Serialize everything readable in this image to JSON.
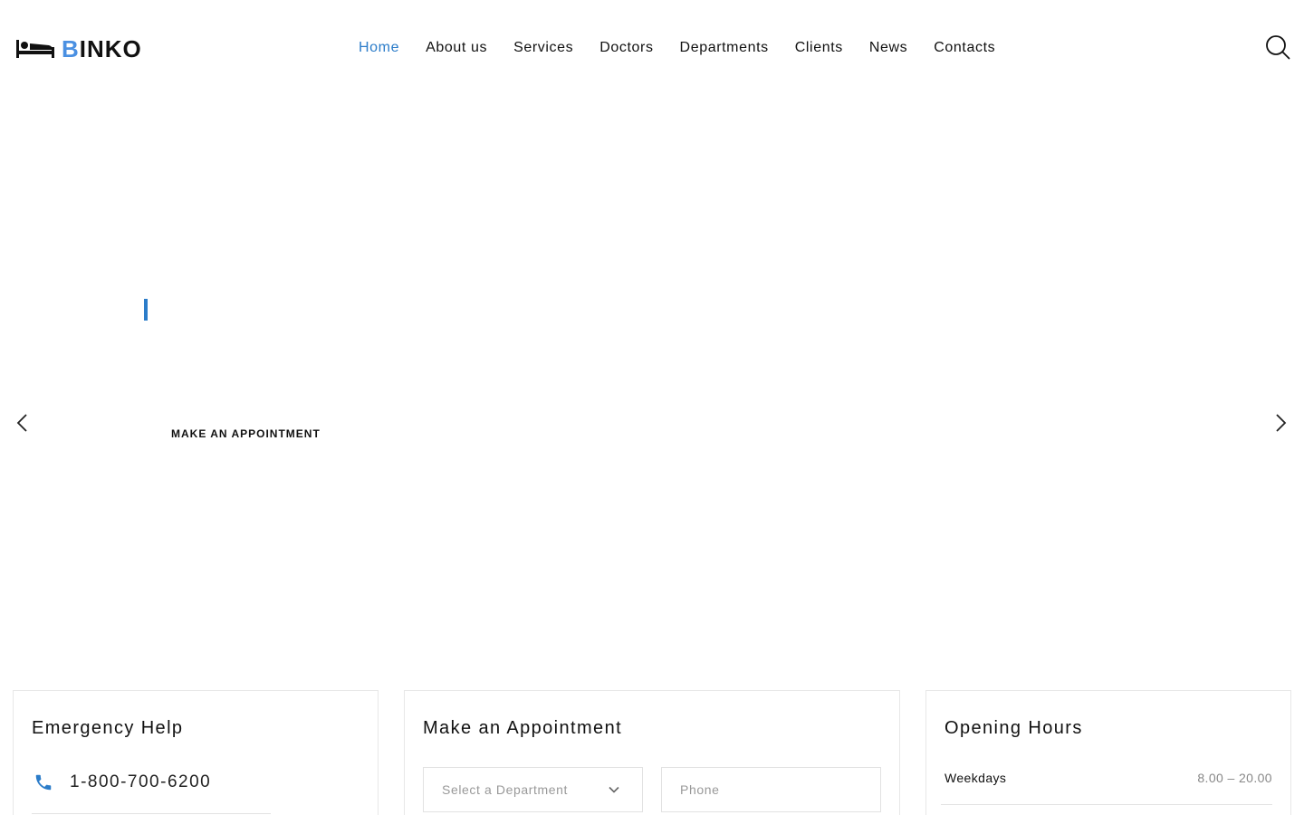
{
  "brand": {
    "logo_first_letter": "B",
    "logo_rest": "INKO",
    "accent_color": "#4a90e2"
  },
  "nav": {
    "items": [
      {
        "label": "Home",
        "active": true
      },
      {
        "label": "About us"
      },
      {
        "label": "Services"
      },
      {
        "label": "Doctors"
      },
      {
        "label": "Departments"
      },
      {
        "label": "Clients"
      },
      {
        "label": "News"
      },
      {
        "label": "Contacts"
      }
    ],
    "active_color": "#2b7cc9",
    "search_icon": "search-icon"
  },
  "hero": {
    "cta_label": "MAKE AN APPOINTMENT",
    "prev_icon": "chevron-left-icon",
    "next_icon": "chevron-right-icon"
  },
  "emergency": {
    "title": "Emergency Help",
    "phone": "1-800-700-6200",
    "icon": "phone-icon"
  },
  "appointment": {
    "title": "Make an Appointment",
    "department_select": "Select a Department",
    "phone_placeholder": "Phone"
  },
  "hours": {
    "title": "Opening Hours",
    "rows": [
      {
        "day": "Weekdays",
        "time": "8.00 – 20.00"
      }
    ]
  }
}
